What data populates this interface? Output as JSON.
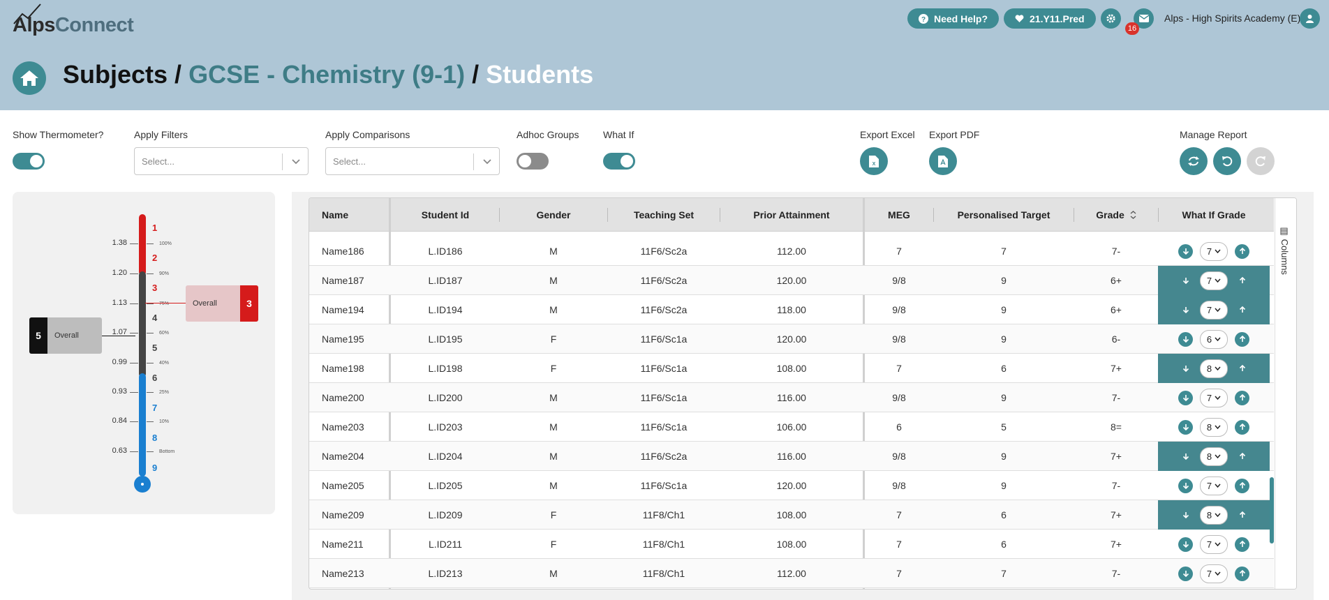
{
  "app": {
    "logo_part1": "Alps",
    "logo_part2": "Connect",
    "help_label": "Need Help?",
    "dataset_label": "21.Y11.Pred",
    "notification_count": "16",
    "school_name": "Alps - High Spirits Academy (E)"
  },
  "breadcrumb": {
    "level1": "Subjects",
    "sep": "/",
    "level2": "GCSE - Chemistry (9-1)",
    "level3": "Students"
  },
  "controls": {
    "show_thermometer_label": "Show Thermometer?",
    "show_thermometer_on": true,
    "apply_filters_label": "Apply Filters",
    "apply_filters_placeholder": "Select...",
    "apply_comparisons_label": "Apply Comparisons",
    "apply_comparisons_placeholder": "Select...",
    "adhoc_groups_label": "Adhoc Groups",
    "adhoc_groups_on": false,
    "what_if_label": "What If",
    "what_if_on": true,
    "export_excel_label": "Export Excel",
    "export_pdf_label": "Export PDF",
    "manage_report_label": "Manage Report"
  },
  "thermometer": {
    "scale_values": [
      "1.38",
      "1.20",
      "1.13",
      "1.07",
      "0.99",
      "0.93",
      "0.84",
      "0.63"
    ],
    "grades": [
      "1",
      "2",
      "3",
      "4",
      "5",
      "6",
      "7",
      "8",
      "9"
    ],
    "percent_labels": [
      "100%",
      "90%",
      "75%",
      "60%",
      "40%",
      "25%",
      "10%",
      "Bottom"
    ],
    "left_marker": {
      "grade": "5",
      "label": "Overall"
    },
    "right_marker": {
      "grade": "3",
      "label": "Overall"
    }
  },
  "table": {
    "columns": [
      "Name",
      "Student Id",
      "Gender",
      "Teaching Set",
      "Prior Attainment",
      "MEG",
      "Personalised Target",
      "Grade",
      "What If Grade"
    ],
    "side_panel_label": "Columns",
    "rows": [
      {
        "name": "Name186",
        "id": "L.ID186",
        "gender": "M",
        "set": "11F6/Sc2a",
        "prior": "112.00",
        "meg": "7",
        "target": "7",
        "grade": "7-",
        "whatif": "7",
        "highlight": false
      },
      {
        "name": "Name187",
        "id": "L.ID187",
        "gender": "M",
        "set": "11F6/Sc2a",
        "prior": "120.00",
        "meg": "9/8",
        "target": "9",
        "grade": "6+",
        "whatif": "7",
        "highlight": true
      },
      {
        "name": "Name194",
        "id": "L.ID194",
        "gender": "M",
        "set": "11F6/Sc2a",
        "prior": "118.00",
        "meg": "9/8",
        "target": "9",
        "grade": "6+",
        "whatif": "7",
        "highlight": true
      },
      {
        "name": "Name195",
        "id": "L.ID195",
        "gender": "F",
        "set": "11F6/Sc1a",
        "prior": "120.00",
        "meg": "9/8",
        "target": "9",
        "grade": "6-",
        "whatif": "6",
        "highlight": false
      },
      {
        "name": "Name198",
        "id": "L.ID198",
        "gender": "F",
        "set": "11F6/Sc1a",
        "prior": "108.00",
        "meg": "7",
        "target": "6",
        "grade": "7+",
        "whatif": "8",
        "highlight": true
      },
      {
        "name": "Name200",
        "id": "L.ID200",
        "gender": "M",
        "set": "11F6/Sc1a",
        "prior": "116.00",
        "meg": "9/8",
        "target": "9",
        "grade": "7-",
        "whatif": "7",
        "highlight": false
      },
      {
        "name": "Name203",
        "id": "L.ID203",
        "gender": "M",
        "set": "11F6/Sc1a",
        "prior": "106.00",
        "meg": "6",
        "target": "5",
        "grade": "8=",
        "whatif": "8",
        "highlight": false
      },
      {
        "name": "Name204",
        "id": "L.ID204",
        "gender": "M",
        "set": "11F6/Sc2a",
        "prior": "116.00",
        "meg": "9/8",
        "target": "9",
        "grade": "7+",
        "whatif": "8",
        "highlight": true
      },
      {
        "name": "Name205",
        "id": "L.ID205",
        "gender": "M",
        "set": "11F6/Sc1a",
        "prior": "120.00",
        "meg": "9/8",
        "target": "9",
        "grade": "7-",
        "whatif": "7",
        "highlight": false
      },
      {
        "name": "Name209",
        "id": "L.ID209",
        "gender": "F",
        "set": "11F8/Ch1",
        "prior": "108.00",
        "meg": "7",
        "target": "6",
        "grade": "7+",
        "whatif": "8",
        "highlight": true
      },
      {
        "name": "Name211",
        "id": "L.ID211",
        "gender": "F",
        "set": "11F8/Ch1",
        "prior": "108.00",
        "meg": "7",
        "target": "6",
        "grade": "7+",
        "whatif": "7",
        "highlight": false
      },
      {
        "name": "Name213",
        "id": "L.ID213",
        "gender": "M",
        "set": "11F8/Ch1",
        "prior": "112.00",
        "meg": "7",
        "target": "7",
        "grade": "7-",
        "whatif": "7",
        "highlight": false
      }
    ]
  },
  "colors": {
    "header_bg": "#aec6d6",
    "accent": "#3e8b93",
    "highlight": "#45878f",
    "thermo_red": "#d51b1b",
    "thermo_dark": "#444444",
    "thermo_blue": "#1a7fd0"
  },
  "icons": [
    "home-icon",
    "question-icon",
    "heart-icon",
    "gear-icon",
    "envelope-icon",
    "user-icon",
    "excel-icon",
    "pdf-icon",
    "refresh-icon",
    "undo-icon",
    "redo-icon",
    "chevron-down-icon",
    "sort-icon",
    "arrow-down-icon",
    "arrow-up-icon",
    "columns-icon"
  ]
}
